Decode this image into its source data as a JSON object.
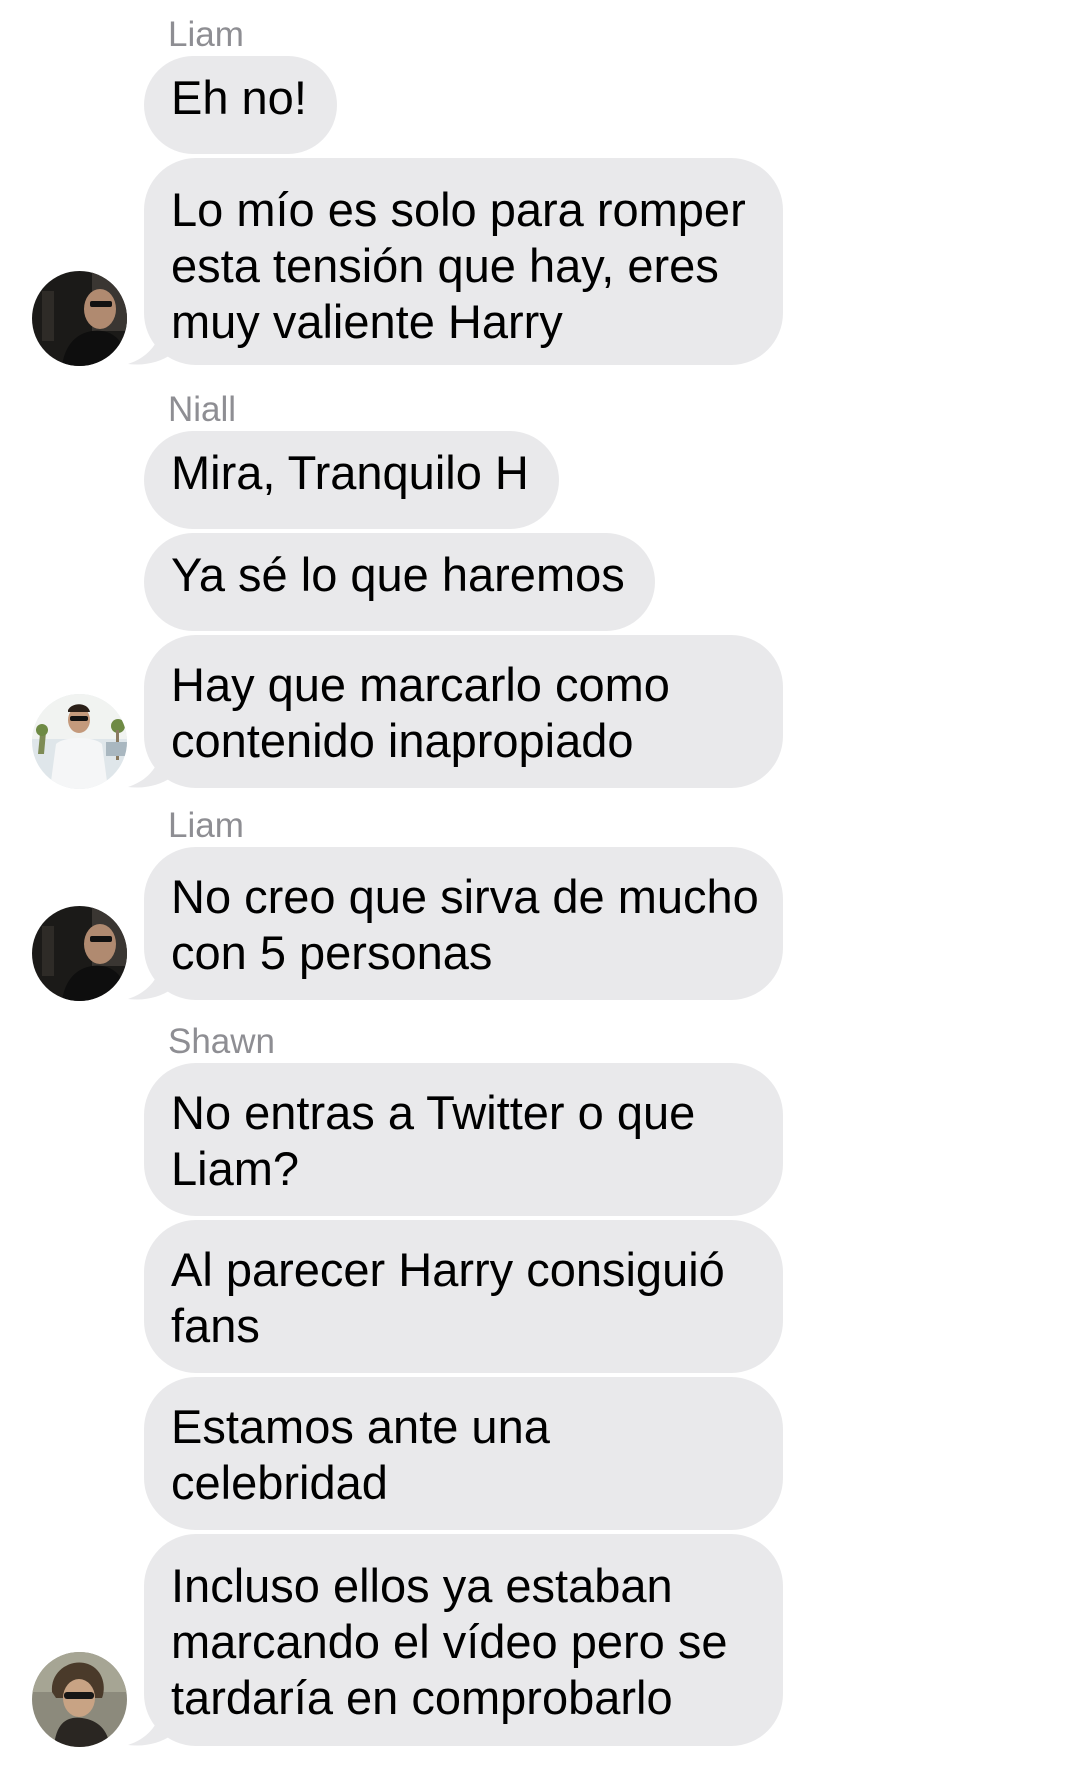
{
  "thread": {
    "groups": [
      {
        "sender": "Liam",
        "avatar_icon": "liam-avatar",
        "messages": [
          "Eh no!",
          "Lo mío es solo para romper\nesta tensión que hay, eres\nmuy valiente Harry"
        ]
      },
      {
        "sender": "Niall",
        "avatar_icon": "niall-avatar",
        "messages": [
          "Mira, Tranquilo H",
          "Ya sé lo que haremos",
          "Hay que marcarlo como\ncontenido inapropiado"
        ]
      },
      {
        "sender": "Liam",
        "avatar_icon": "liam-avatar",
        "messages": [
          "No creo que sirva de mucho\ncon 5 personas"
        ]
      },
      {
        "sender": "Shawn",
        "avatar_icon": "shawn-avatar",
        "messages": [
          "No entras a Twitter o que\nLiam?",
          "Al parecer Harry consiguió\nfans",
          "Estamos ante una\ncelebridad",
          "Incluso ellos ya estaban\nmarcando el vídeo pero se\ntardaría en comprobarlo"
        ]
      }
    ]
  },
  "colors": {
    "background": "#ffffff",
    "bubble": "#e9e9eb",
    "sender_name": "#8e8e93",
    "text": "#000000"
  }
}
